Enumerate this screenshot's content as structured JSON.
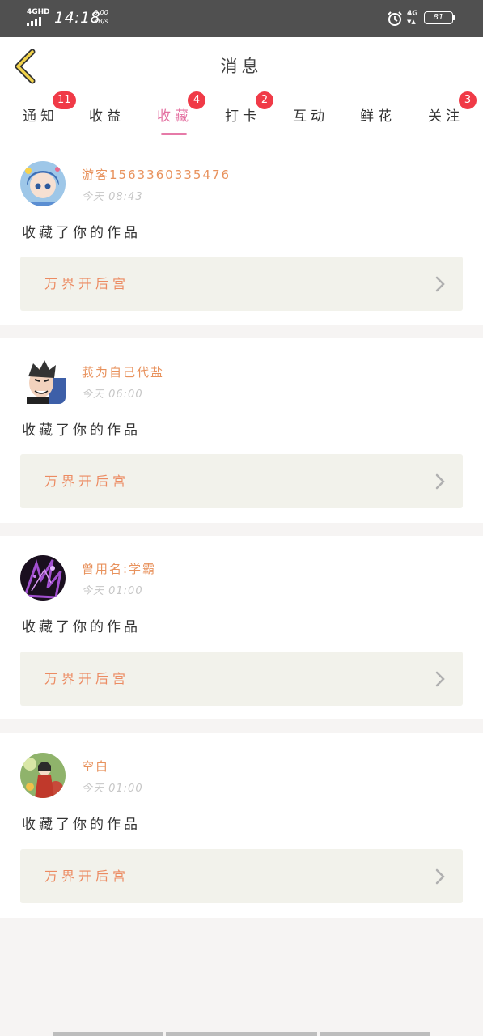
{
  "status_bar": {
    "network": "4GHD",
    "time": "14:18",
    "speed_value": "0.00",
    "speed_unit": "KB/s",
    "mobile": "4G",
    "battery": "81"
  },
  "header": {
    "title": "消息"
  },
  "tabs": [
    {
      "label": "通知",
      "badge": "11"
    },
    {
      "label": "收益",
      "badge": ""
    },
    {
      "label": "收藏",
      "badge": "4",
      "active": true
    },
    {
      "label": "打卡",
      "badge": "2"
    },
    {
      "label": "互动",
      "badge": ""
    },
    {
      "label": "鲜花",
      "badge": ""
    },
    {
      "label": "关注",
      "badge": "3"
    }
  ],
  "messages": [
    {
      "username": "游客1563360335476",
      "time": "今天 08:43",
      "action": "收藏了你的作品",
      "work_title": "万界开后宫",
      "avatar": "anime-girl-blue-avatar"
    },
    {
      "username": "莪为自己代盐",
      "time": "今天 06:00",
      "action": "收藏了你的作品",
      "work_title": "万界开后宫",
      "avatar": "cartoon-man-avatar"
    },
    {
      "username": "曾用名:学霸",
      "time": "今天 01:00",
      "action": "收藏了你的作品",
      "work_title": "万界开后宫",
      "avatar": "purple-dark-avatar"
    },
    {
      "username": "空白",
      "time": "今天 01:00",
      "action": "收藏了你的作品",
      "work_title": "万界开后宫",
      "avatar": "girl-in-red-avatar"
    }
  ],
  "colors": {
    "accent": "#e472a2",
    "badge": "#f03a47",
    "username": "#e8925d",
    "work_title": "#ec8b62",
    "work_box_bg": "#f2f2eb"
  }
}
